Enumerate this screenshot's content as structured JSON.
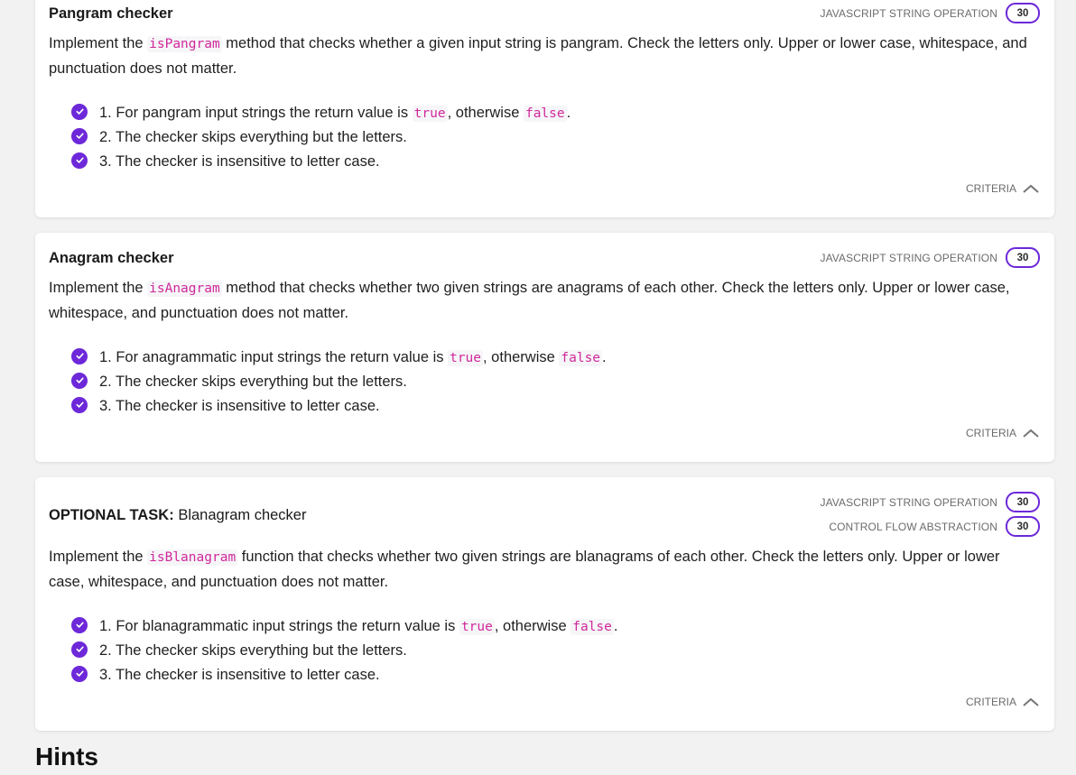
{
  "tasks": [
    {
      "title_prefix": "",
      "title": "Pangram checker",
      "tags": [
        {
          "label": "JAVASCRIPT STRING OPERATION",
          "score": "30"
        }
      ],
      "desc_before": "Implement the ",
      "desc_code": "isPangram",
      "desc_after": " method that checks whether a given input string is pangram. Check the letters only. Upper or lower case, whitespace, and punctuation does not matter.",
      "criteria": [
        {
          "before": "1. For pangram input strings the return value is ",
          "code1": "true",
          "mid": ", otherwise ",
          "code2": "false",
          "after": "."
        },
        {
          "text": "2. The checker skips everything but the letters."
        },
        {
          "text": "3. The checker is insensitive to letter case."
        }
      ],
      "footer": "CRITERIA"
    },
    {
      "title_prefix": "",
      "title": "Anagram checker",
      "tags": [
        {
          "label": "JAVASCRIPT STRING OPERATION",
          "score": "30"
        }
      ],
      "desc_before": "Implement the ",
      "desc_code": "isAnagram",
      "desc_after": " method that checks whether two given strings are anagrams of each other. Check the letters only. Upper or lower case, whitespace, and punctuation does not matter.",
      "criteria": [
        {
          "before": "1. For anagrammatic input strings the return value is ",
          "code1": "true",
          "mid": ", otherwise ",
          "code2": "false",
          "after": "."
        },
        {
          "text": "2. The checker skips everything but the letters."
        },
        {
          "text": "3. The checker is insensitive to letter case."
        }
      ],
      "footer": "CRITERIA"
    },
    {
      "title_prefix": "OPTIONAL TASK:",
      "title": "Blanagram checker",
      "tags": [
        {
          "label": "JAVASCRIPT STRING OPERATION",
          "score": "30"
        },
        {
          "label": "CONTROL FLOW ABSTRACTION",
          "score": "30"
        }
      ],
      "desc_before": "Implement the ",
      "desc_code": "isBlanagram",
      "desc_after": " function that checks whether two given strings are blanagrams of each other. Check the letters only. Upper or lower case, whitespace, and punctuation does not matter.",
      "criteria": [
        {
          "before": "1. For blanagrammatic input strings the return value is ",
          "code1": "true",
          "mid": ", otherwise ",
          "code2": "false",
          "after": "."
        },
        {
          "text": "2. The checker skips everything but the letters."
        },
        {
          "text": "3. The checker is insensitive to letter case."
        }
      ],
      "footer": "CRITERIA"
    }
  ],
  "hints_heading": "Hints",
  "colors": {
    "accent": "#6d28d9",
    "code": "#d0289b",
    "muted": "#6b6b6b"
  },
  "icons": {
    "check": "check-circle-icon",
    "collapse": "chevron-up-icon"
  }
}
